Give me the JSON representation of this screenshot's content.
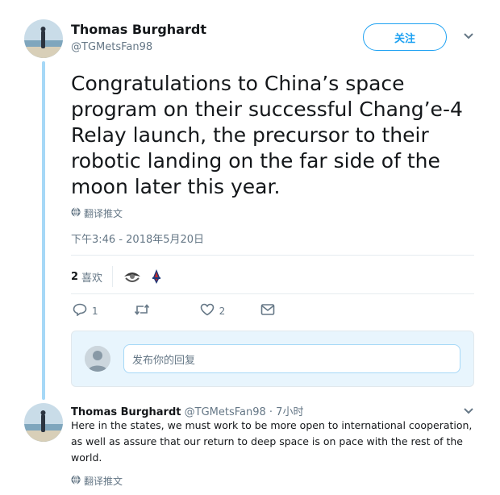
{
  "tweet": {
    "author_name": "Thomas Burghardt",
    "author_handle": "@TGMetsFan98",
    "follow_label": "关注",
    "text": "Congratulations to China’s space program on their successful Chang’e-4 Relay launch, the precursor to their robotic landing on the far side of the moon later this year.",
    "translate_label": "翻译推文",
    "timestamp": "下午3:46 - 2018年5月20日",
    "likes_count": "2",
    "likes_label": "喜欢",
    "reply_count": "1",
    "like_action_count": "2"
  },
  "reply_box": {
    "placeholder": "发布你的回复"
  },
  "reply": {
    "author_name": "Thomas Burghardt",
    "author_handle": "@TGMetsFan98",
    "time": "· 7小时",
    "text": "Here in the states, we must work to be more open to international cooperation, as well as assure that our return to deep space is on pace with the rest of the world.",
    "translate_label": "翻译推文"
  },
  "icons": {
    "caret": "chevron-down-icon",
    "globe": "globe-icon",
    "reply": "reply-icon",
    "retweet": "retweet-icon",
    "like": "heart-icon",
    "dm": "envelope-icon"
  },
  "colors": {
    "accent": "#1da1f2",
    "thread_line": "#a6d8f7",
    "muted": "#657786",
    "reply_box_bg": "#e8f5fd"
  }
}
